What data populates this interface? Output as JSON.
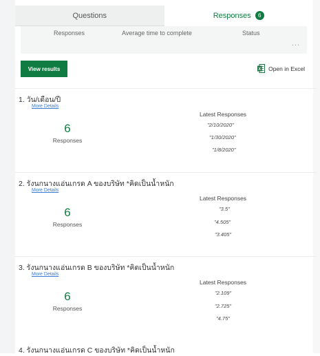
{
  "tabs": [
    {
      "label": "Questions",
      "active": false
    },
    {
      "label": "Responses",
      "active": true,
      "badge": "6"
    }
  ],
  "summary": {
    "columns": [
      "Responses",
      "Average time to complete",
      "Status"
    ],
    "more": "..."
  },
  "actions": {
    "view_results": "View results",
    "open_excel": "Open in Excel"
  },
  "questions": [
    {
      "title": "1. วัน/เดือน/ปี",
      "more_details": "More Details",
      "count": "6",
      "count_label": "Responses",
      "latest_title": "Latest Responses",
      "latest": [
        "\"2/10/2020\"",
        "\"1/30/2020\"",
        "\"1/8/2020\""
      ]
    },
    {
      "title": "2. รังนกนางแอ่นเกรด A ของบริษัท *คิดเป็นน้ำหนัก",
      "more_details": "More Details",
      "count": "6",
      "count_label": "Responses",
      "latest_title": "Latest Responses",
      "latest": [
        "\"3.5\"",
        "\"4.505\"",
        "\"3.405\""
      ]
    },
    {
      "title": "3. รังนกนางแอ่นเกรด B ของบริษัท *คิดเป็นน้ำหนัก",
      "more_details": "More Details",
      "count": "6",
      "count_label": "Responses",
      "latest_title": "Latest Responses",
      "latest": [
        "\"2.109\"",
        "\"2.725\"",
        "\"4.75\""
      ]
    }
  ],
  "partial_question": "4. รังนกนางแอ่นเกรด C ของบริษัท *คิดเป็นน้ำหนัก",
  "colors": {
    "accent": "#107c41",
    "link": "#3a7bd5"
  }
}
